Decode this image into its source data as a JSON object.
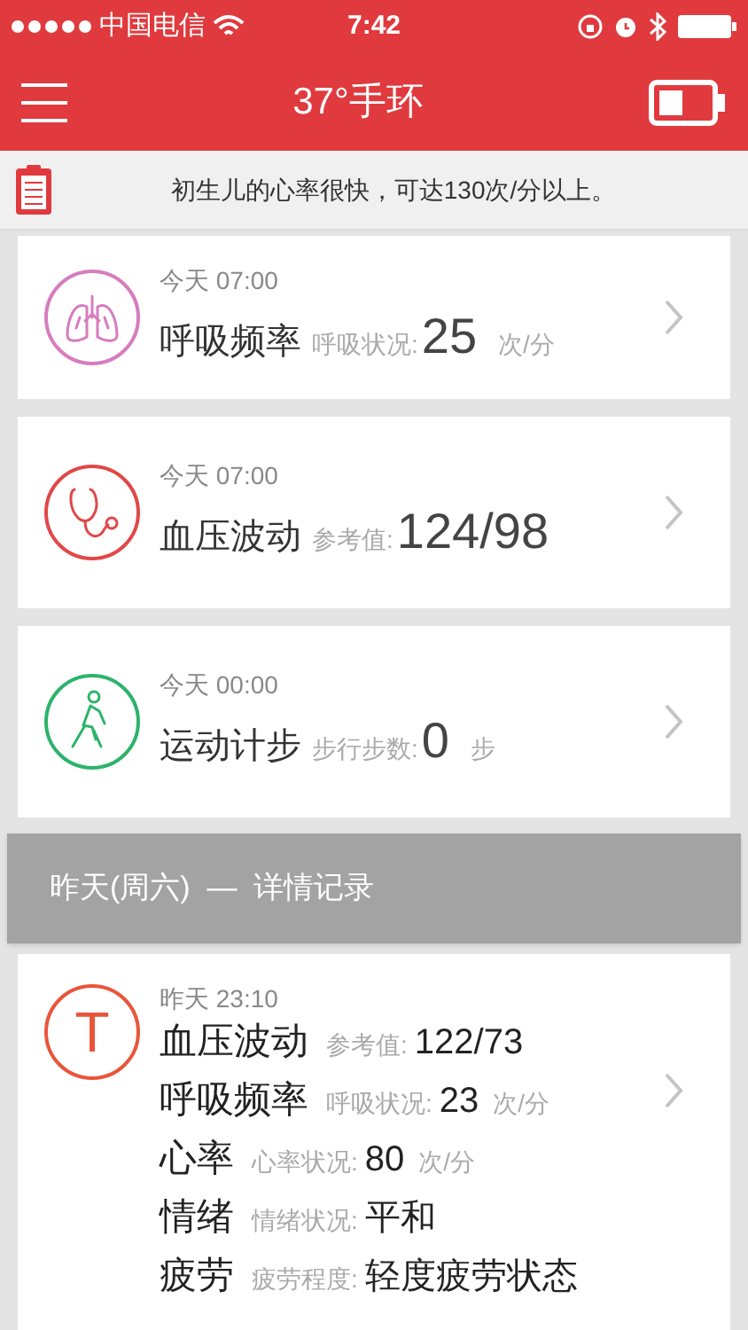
{
  "status_bar": {
    "carrier": "中国电信",
    "time": "7:42"
  },
  "nav": {
    "title": "37°手环"
  },
  "tip": {
    "text": "初生儿的心率很快，可达130次/分以上。"
  },
  "records": [
    {
      "kind": "lungs",
      "color": "#d77cbf",
      "time": "今天 07:00",
      "name": "呼吸频率",
      "label": "呼吸状况:",
      "value": "25",
      "unit": "次/分"
    },
    {
      "kind": "stethoscope",
      "color": "#e04848",
      "time": "今天 07:00",
      "name": "血压波动",
      "label": "参考值:",
      "value": "124/98"
    },
    {
      "kind": "walker",
      "color": "#2db36b",
      "time": "今天 00:00",
      "name": "运动计步",
      "label": "步行步数:",
      "value": "0",
      "unit": "步"
    }
  ],
  "section_header": {
    "text": "昨天(周六)  —  详情记录"
  },
  "detail": {
    "kind": "letter",
    "letter": "T",
    "color": "#e9553a",
    "time": "昨天 23:10",
    "rows": [
      {
        "name": "血压波动",
        "label": "参考值:",
        "value": "122/73"
      },
      {
        "name": "呼吸频率",
        "label": "呼吸状况:",
        "value": "23",
        "unit": "次/分"
      },
      {
        "name": "心率",
        "label": "心率状况:",
        "value": "80",
        "unit": "次/分"
      },
      {
        "name": "情绪",
        "label": "情绪状况:",
        "value": "平和"
      },
      {
        "name": "疲劳",
        "label": "疲劳程度:",
        "value": "轻度疲劳状态"
      }
    ]
  }
}
